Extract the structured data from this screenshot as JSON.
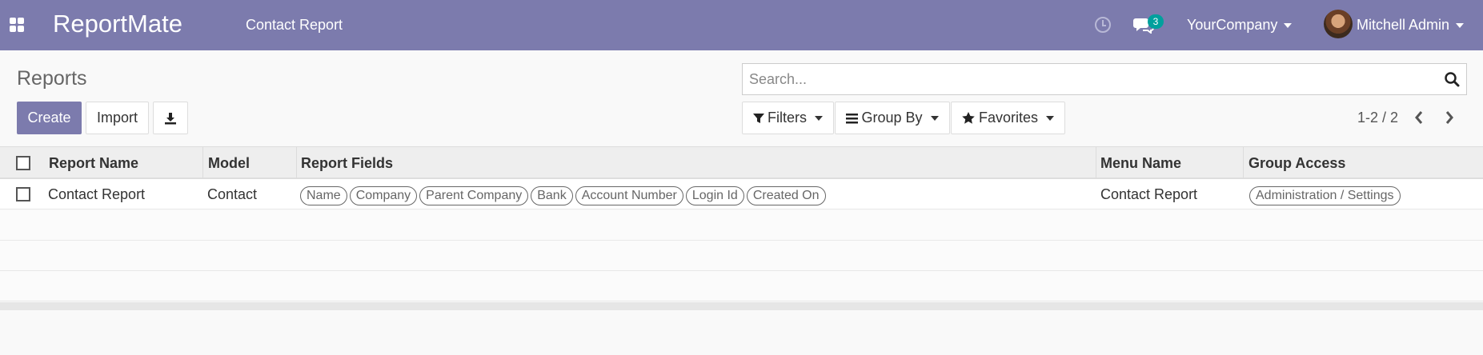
{
  "navbar": {
    "brand": "ReportMate",
    "menu_item": "Contact Report",
    "chat_badge": "3",
    "company": "YourCompany",
    "user": "Mitchell Admin",
    "icons": [
      "apps-icon",
      "clock-icon",
      "chat-icon",
      "avatar"
    ],
    "color": "#7c7bad"
  },
  "control_panel": {
    "title": "Reports",
    "create_label": "Create",
    "import_label": "Import",
    "search_placeholder": "Search...",
    "filters_label": "Filters",
    "group_by_label": "Group By",
    "favorites_label": "Favorites",
    "pager": "1-2 / 2"
  },
  "table": {
    "columns": [
      "Report Name",
      "Model",
      "Report Fields",
      "Menu Name",
      "Group Access"
    ],
    "rows": [
      {
        "report_name": "Contact Report",
        "model": "Contact",
        "report_fields": [
          "Name",
          "Company",
          "Parent Company",
          "Bank",
          "Account Number",
          "Login Id",
          "Created On"
        ],
        "menu_name": "Contact Report",
        "group_access": "Administration / Settings"
      }
    ]
  }
}
